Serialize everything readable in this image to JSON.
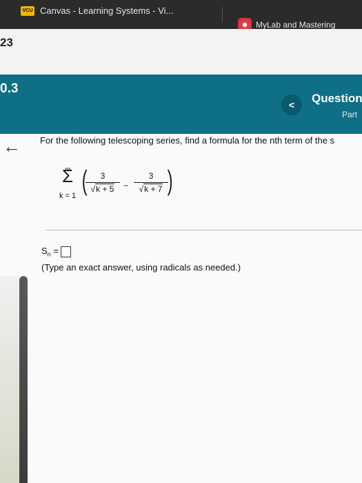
{
  "browser": {
    "tab1_label": "Canvas - Learning Systems - Vi...",
    "tab1_icon_text": "VCU",
    "tab2_label": "MyLab and Mastering"
  },
  "sidebar": {
    "number_top": "23",
    "section_number": "0.3"
  },
  "header": {
    "prev_symbol": "<",
    "question_label": "Question",
    "part_label": "Part"
  },
  "problem": {
    "prompt": "For the following telescoping series, find a formula for the nth term of the s",
    "sum_upper": "∞",
    "sum_symbol": "Σ",
    "sum_lower": "k = 1",
    "term1_num": "3",
    "term1_den": "k + 5",
    "term2_num": "3",
    "term2_den": "k + 7",
    "minus": "−"
  },
  "answer": {
    "label_s": "S",
    "label_n": "n",
    "equals": "=",
    "hint": "(Type an exact answer, using radicals as needed.)"
  },
  "nav": {
    "back_arrow": "←"
  }
}
